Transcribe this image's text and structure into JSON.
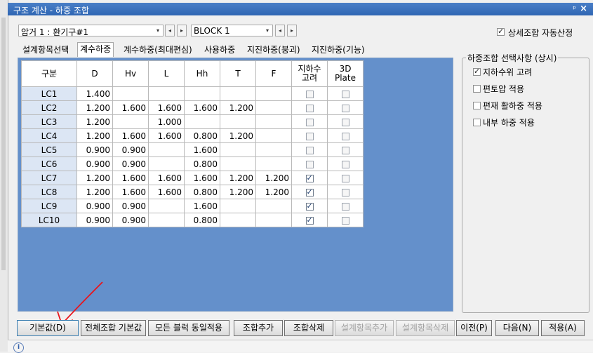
{
  "window": {
    "title": "구조 계산 - 하중 조합",
    "pin_glyph": "ᵖ",
    "close_glyph": "×"
  },
  "top_bar": {
    "combo1_value": "암거 1 : 환기구#1",
    "combo2_value": "BLOCK  1",
    "prev_glyph": "◂",
    "next_glyph": "▸",
    "drop_glyph": "▾",
    "auto_select_label": "상세조합 자동산정",
    "auto_select_checked": true
  },
  "tabs": [
    {
      "label": "설계항목선택",
      "active": false
    },
    {
      "label": "계수하중",
      "active": true
    },
    {
      "label": "계수하중(최대편심)",
      "active": false
    },
    {
      "label": "사용하중",
      "active": false
    },
    {
      "label": "지진하중(붕괴)",
      "active": false
    },
    {
      "label": "지진하중(기능)",
      "active": false
    }
  ],
  "grid": {
    "headers": [
      "구분",
      "D",
      "Hv",
      "L",
      "Hh",
      "T",
      "F",
      "지하수\n고려",
      "3D\nPlate"
    ],
    "rows": [
      {
        "name": "LC1",
        "D": "1.400",
        "Hv": "",
        "L": "",
        "Hh": "",
        "T": "",
        "F": "",
        "gw": false,
        "plate": false
      },
      {
        "name": "LC2",
        "D": "1.200",
        "Hv": "1.600",
        "L": "1.600",
        "Hh": "1.600",
        "T": "1.200",
        "F": "",
        "gw": false,
        "plate": false
      },
      {
        "name": "LC3",
        "D": "1.200",
        "Hv": "",
        "L": "1.000",
        "Hh": "",
        "T": "",
        "F": "",
        "gw": false,
        "plate": false
      },
      {
        "name": "LC4",
        "D": "1.200",
        "Hv": "1.600",
        "L": "1.600",
        "Hh": "0.800",
        "T": "1.200",
        "F": "",
        "gw": false,
        "plate": false
      },
      {
        "name": "LC5",
        "D": "0.900",
        "Hv": "0.900",
        "L": "",
        "Hh": "1.600",
        "T": "",
        "F": "",
        "gw": false,
        "plate": false
      },
      {
        "name": "LC6",
        "D": "0.900",
        "Hv": "0.900",
        "L": "",
        "Hh": "0.800",
        "T": "",
        "F": "",
        "gw": false,
        "plate": false
      },
      {
        "name": "LC7",
        "D": "1.200",
        "Hv": "1.600",
        "L": "1.600",
        "Hh": "1.600",
        "T": "1.200",
        "F": "1.200",
        "gw": true,
        "plate": false
      },
      {
        "name": "LC8",
        "D": "1.200",
        "Hv": "1.600",
        "L": "1.600",
        "Hh": "0.800",
        "T": "1.200",
        "F": "1.200",
        "gw": true,
        "plate": false
      },
      {
        "name": "LC9",
        "D": "0.900",
        "Hv": "0.900",
        "L": "",
        "Hh": "1.600",
        "T": "",
        "F": "",
        "gw": true,
        "plate": false
      },
      {
        "name": "LC10",
        "D": "0.900",
        "Hv": "0.900",
        "L": "",
        "Hh": "0.800",
        "T": "",
        "F": "",
        "gw": true,
        "plate": false
      }
    ]
  },
  "options_group": {
    "legend": "하중조합 선택사항 (상시)",
    "items": [
      {
        "label": "지하수위 고려",
        "checked": true
      },
      {
        "label": "편토압 적용",
        "checked": false
      },
      {
        "label": "편재 활하중 적용",
        "checked": false
      },
      {
        "label": "내부 하중 적용",
        "checked": false
      }
    ]
  },
  "buttons": {
    "default": "기본값(D)",
    "all_default": "전체조합 기본값",
    "apply_all_blocks": "모든 블럭 동일적용",
    "add_combo": "조합추가",
    "delete_combo": "조합삭제",
    "add_item": "설계항목추가",
    "delete_item": "설계항목삭제",
    "prev": "이전(P)",
    "next": "다음(N)",
    "apply": "적용(A)"
  },
  "status": {
    "info_glyph": "i"
  },
  "colors": {
    "grid_panel_bg": "#6490cb",
    "lc_cell_bg": "#dce6f4",
    "annotation_arrow": "#e8141c"
  }
}
